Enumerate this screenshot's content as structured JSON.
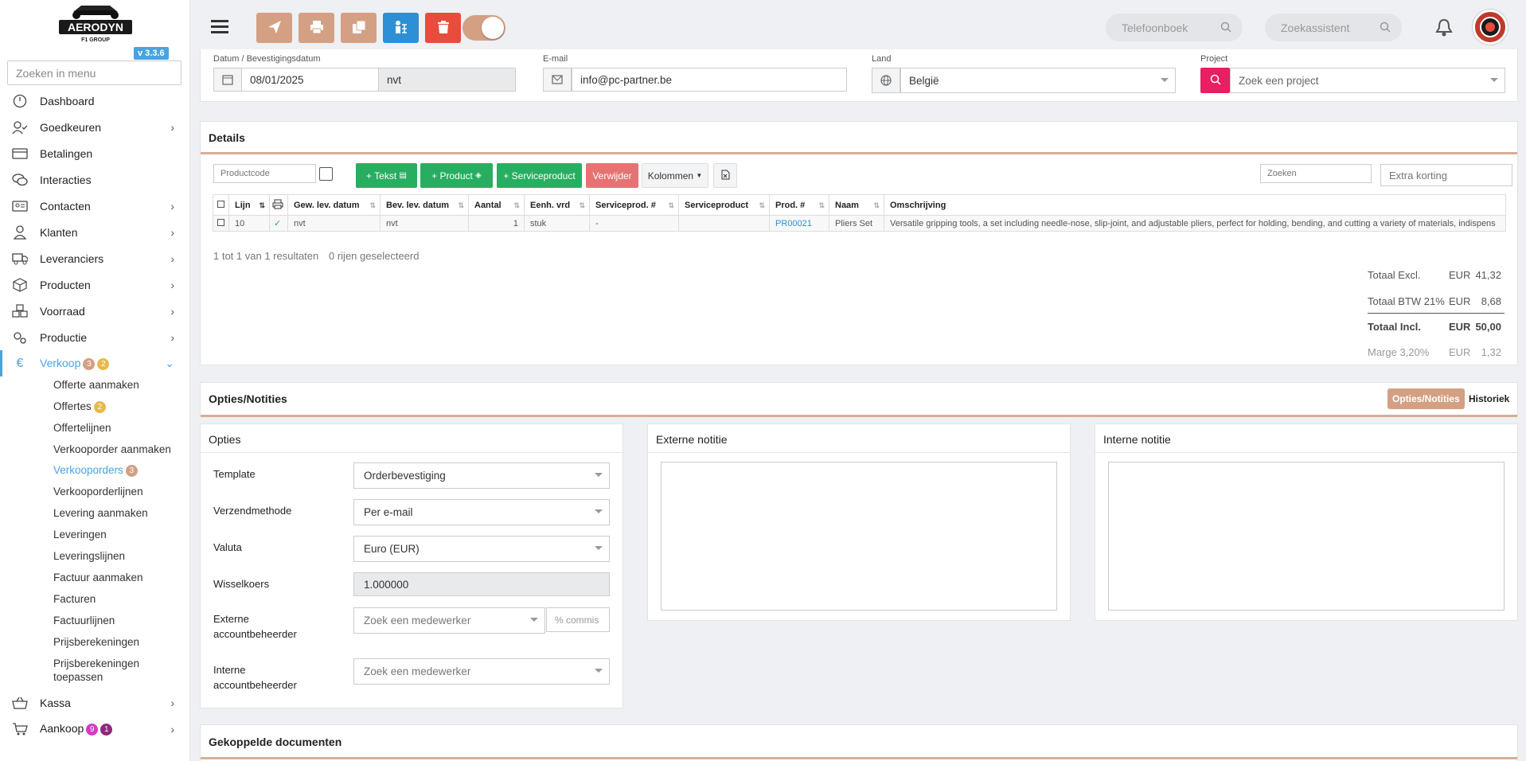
{
  "sidebar": {
    "version": "v 3.3.6",
    "search_placeholder": "Zoeken in menu",
    "items": [
      {
        "label": "Dashboard"
      },
      {
        "label": "Goedkeuren"
      },
      {
        "label": "Betalingen"
      },
      {
        "label": "Interacties"
      },
      {
        "label": "Contacten"
      },
      {
        "label": "Klanten"
      },
      {
        "label": "Leveranciers"
      },
      {
        "label": "Producten"
      },
      {
        "label": "Voorraad"
      },
      {
        "label": "Productie"
      },
      {
        "label": "Verkoop",
        "badge1": "3",
        "badge2": "2"
      },
      {
        "label": "Kassa"
      },
      {
        "label": "Aankoop",
        "badge1": "9",
        "badge2": "1"
      }
    ],
    "sub_items": [
      {
        "label": "Offerte aanmaken"
      },
      {
        "label": "Offertes",
        "badge": "2"
      },
      {
        "label": "Offertelijnen"
      },
      {
        "label": "Verkooporder aanmaken"
      },
      {
        "label": "Verkooporders",
        "badge": "3"
      },
      {
        "label": "Verkooporderlijnen"
      },
      {
        "label": "Levering aanmaken"
      },
      {
        "label": "Leveringen"
      },
      {
        "label": "Leveringslijnen"
      },
      {
        "label": "Factuur aanmaken"
      },
      {
        "label": "Facturen"
      },
      {
        "label": "Factuurlijnen"
      },
      {
        "label": "Prijsberekeningen"
      },
      {
        "label": "Prijsberekeningen toepassen"
      }
    ]
  },
  "topbar": {
    "phonebook_placeholder": "Telefoonboek",
    "assistant_placeholder": "Zoekassistent"
  },
  "header_fields": {
    "date_label": "Datum / Bevestigingsdatum",
    "date_value": "08/01/2025",
    "confirm_value": "nvt",
    "email_label": "E-mail",
    "email_value": "info@pc-partner.be",
    "country_label": "Land",
    "country_value": "België",
    "project_label": "Project",
    "project_placeholder": "Zoek een project"
  },
  "details": {
    "title": "Details",
    "productcode_placeholder": "Productcode",
    "btn_text": "+ Tekst",
    "btn_product": "+ Product",
    "btn_service": "+ Serviceproduct",
    "btn_delete": "Verwijder",
    "btn_columns": "Kolommen",
    "search_placeholder": "Zoeken",
    "discount_placeholder": "Extra korting",
    "columns": [
      "Lijn",
      "Gew. lev. datum",
      "Bev. lev. datum",
      "Aantal",
      "Eenh. vrd",
      "Serviceprod. #",
      "Serviceproduct",
      "Prod. #",
      "Naam",
      "Omschrijving"
    ],
    "rows": [
      {
        "line": "10",
        "req_date": "nvt",
        "conf_date": "nvt",
        "qty": "1",
        "unit": "stuk",
        "service_no": "-",
        "service": "",
        "prod_no": "PR00021",
        "name": "Pliers Set",
        "desc": "Versatile gripping tools, a set including needle-nose, slip-joint, and adjustable pliers, perfect for holding, bending, and cutting a variety of materials, indispens"
      }
    ],
    "result_text": "1 tot 1 van 1 resultaten",
    "selected_text": "0 rijen geselecteerd",
    "totals": [
      {
        "label": "Totaal Excl.",
        "currency": "EUR",
        "value": "41,32"
      },
      {
        "label": "Totaal BTW 21%",
        "currency": "EUR",
        "value": "8,68"
      },
      {
        "label": "Totaal Incl.",
        "currency": "EUR",
        "value": "50,00"
      },
      {
        "label": "Marge 3,20%",
        "currency": "EUR",
        "value": "1,32"
      }
    ]
  },
  "options_section": {
    "title": "Opties/Notities",
    "tab_active": "Opties/Notities",
    "tab_history": "Historiek",
    "opties_title": "Opties",
    "template_label": "Template",
    "template_value": "Orderbevestiging",
    "shipping_label": "Verzendmethode",
    "shipping_value": "Per e-mail",
    "currency_label": "Valuta",
    "currency_value": "Euro (EUR)",
    "rate_label": "Wisselkoers",
    "rate_value": "1.000000",
    "ext_manager_label": "Externe accountbeheerder",
    "ext_manager_placeholder": "Zoek een medewerker",
    "commission_placeholder": "% commis",
    "int_manager_label": "Interne accountbeheerder",
    "int_manager_placeholder": "Zoek een medewerker",
    "ext_note_title": "Externe notitie",
    "int_note_title": "Interne notitie"
  },
  "linked_docs": {
    "title": "Gekoppelde documenten"
  },
  "colors": {
    "accent": "#4aa3df",
    "tan": "#d3a083",
    "green": "#27ae60",
    "red": "#e74c3c",
    "pink": "#e91e63"
  }
}
